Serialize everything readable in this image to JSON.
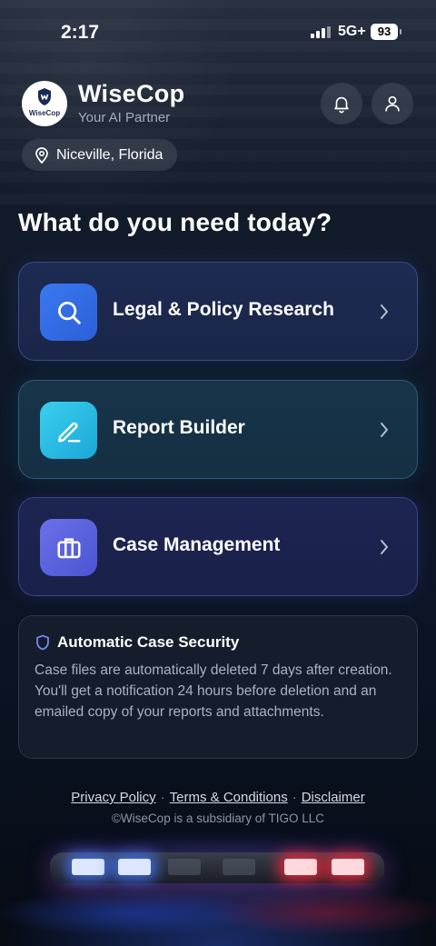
{
  "status_bar": {
    "time": "2:17",
    "network": "5G+",
    "battery": "93"
  },
  "header": {
    "logo_text": "WiseCop",
    "title": "WiseCop",
    "subtitle": "Your AI Partner",
    "notification_icon": "bell-icon",
    "profile_icon": "user-icon"
  },
  "location": {
    "icon": "map-pin-icon",
    "label": "Niceville, Florida"
  },
  "headline": "What do you need today?",
  "actions": [
    {
      "label": "Legal & Policy Research",
      "icon": "search-icon",
      "accent": "#3a79f0"
    },
    {
      "label": "Report Builder",
      "icon": "pencil-icon",
      "accent": "#2bbbe6"
    },
    {
      "label": "Case Management",
      "icon": "briefcase-icon",
      "accent": "#5a62dd"
    }
  ],
  "notice": {
    "icon": "shield-icon",
    "title": "Automatic Case Security",
    "body": "Case files are automatically deleted 7 days after creation. You'll get a notification 24 hours before deletion and an emailed copy of your reports and attachments."
  },
  "footer": {
    "links": [
      "Privacy Policy",
      "Terms & Conditions",
      "Disclaimer"
    ],
    "separator": "·",
    "copyright": "©WiseCop is a subsidiary of TIGO LLC"
  },
  "colors": {
    "background": "#0e1828",
    "siren_blue": "#4678ff",
    "siren_red": "#ff283c"
  }
}
